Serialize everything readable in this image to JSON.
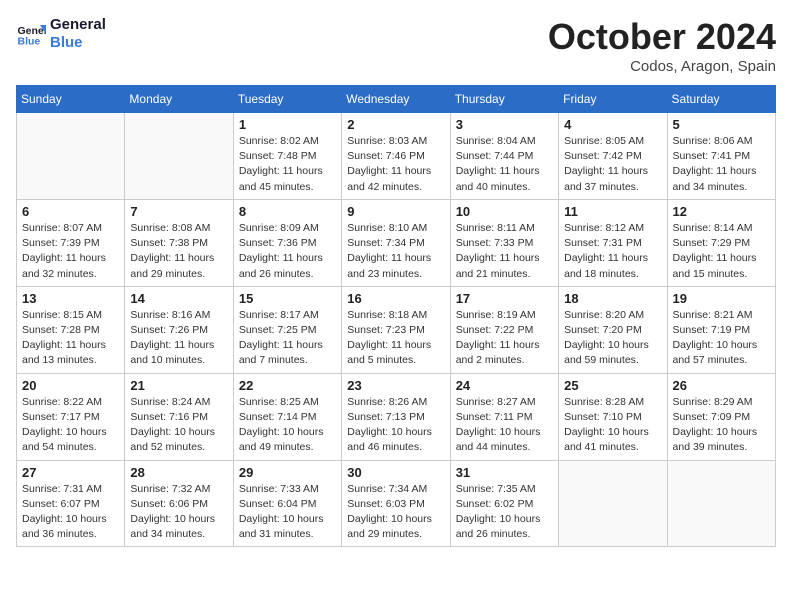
{
  "logo": {
    "text_general": "General",
    "text_blue": "Blue"
  },
  "header": {
    "month": "October 2024",
    "location": "Codos, Aragon, Spain"
  },
  "weekdays": [
    "Sunday",
    "Monday",
    "Tuesday",
    "Wednesday",
    "Thursday",
    "Friday",
    "Saturday"
  ],
  "weeks": [
    [
      {
        "day": "",
        "info": ""
      },
      {
        "day": "",
        "info": ""
      },
      {
        "day": "1",
        "info": "Sunrise: 8:02 AM\nSunset: 7:48 PM\nDaylight: 11 hours and 45 minutes."
      },
      {
        "day": "2",
        "info": "Sunrise: 8:03 AM\nSunset: 7:46 PM\nDaylight: 11 hours and 42 minutes."
      },
      {
        "day": "3",
        "info": "Sunrise: 8:04 AM\nSunset: 7:44 PM\nDaylight: 11 hours and 40 minutes."
      },
      {
        "day": "4",
        "info": "Sunrise: 8:05 AM\nSunset: 7:42 PM\nDaylight: 11 hours and 37 minutes."
      },
      {
        "day": "5",
        "info": "Sunrise: 8:06 AM\nSunset: 7:41 PM\nDaylight: 11 hours and 34 minutes."
      }
    ],
    [
      {
        "day": "6",
        "info": "Sunrise: 8:07 AM\nSunset: 7:39 PM\nDaylight: 11 hours and 32 minutes."
      },
      {
        "day": "7",
        "info": "Sunrise: 8:08 AM\nSunset: 7:38 PM\nDaylight: 11 hours and 29 minutes."
      },
      {
        "day": "8",
        "info": "Sunrise: 8:09 AM\nSunset: 7:36 PM\nDaylight: 11 hours and 26 minutes."
      },
      {
        "day": "9",
        "info": "Sunrise: 8:10 AM\nSunset: 7:34 PM\nDaylight: 11 hours and 23 minutes."
      },
      {
        "day": "10",
        "info": "Sunrise: 8:11 AM\nSunset: 7:33 PM\nDaylight: 11 hours and 21 minutes."
      },
      {
        "day": "11",
        "info": "Sunrise: 8:12 AM\nSunset: 7:31 PM\nDaylight: 11 hours and 18 minutes."
      },
      {
        "day": "12",
        "info": "Sunrise: 8:14 AM\nSunset: 7:29 PM\nDaylight: 11 hours and 15 minutes."
      }
    ],
    [
      {
        "day": "13",
        "info": "Sunrise: 8:15 AM\nSunset: 7:28 PM\nDaylight: 11 hours and 13 minutes."
      },
      {
        "day": "14",
        "info": "Sunrise: 8:16 AM\nSunset: 7:26 PM\nDaylight: 11 hours and 10 minutes."
      },
      {
        "day": "15",
        "info": "Sunrise: 8:17 AM\nSunset: 7:25 PM\nDaylight: 11 hours and 7 minutes."
      },
      {
        "day": "16",
        "info": "Sunrise: 8:18 AM\nSunset: 7:23 PM\nDaylight: 11 hours and 5 minutes."
      },
      {
        "day": "17",
        "info": "Sunrise: 8:19 AM\nSunset: 7:22 PM\nDaylight: 11 hours and 2 minutes."
      },
      {
        "day": "18",
        "info": "Sunrise: 8:20 AM\nSunset: 7:20 PM\nDaylight: 10 hours and 59 minutes."
      },
      {
        "day": "19",
        "info": "Sunrise: 8:21 AM\nSunset: 7:19 PM\nDaylight: 10 hours and 57 minutes."
      }
    ],
    [
      {
        "day": "20",
        "info": "Sunrise: 8:22 AM\nSunset: 7:17 PM\nDaylight: 10 hours and 54 minutes."
      },
      {
        "day": "21",
        "info": "Sunrise: 8:24 AM\nSunset: 7:16 PM\nDaylight: 10 hours and 52 minutes."
      },
      {
        "day": "22",
        "info": "Sunrise: 8:25 AM\nSunset: 7:14 PM\nDaylight: 10 hours and 49 minutes."
      },
      {
        "day": "23",
        "info": "Sunrise: 8:26 AM\nSunset: 7:13 PM\nDaylight: 10 hours and 46 minutes."
      },
      {
        "day": "24",
        "info": "Sunrise: 8:27 AM\nSunset: 7:11 PM\nDaylight: 10 hours and 44 minutes."
      },
      {
        "day": "25",
        "info": "Sunrise: 8:28 AM\nSunset: 7:10 PM\nDaylight: 10 hours and 41 minutes."
      },
      {
        "day": "26",
        "info": "Sunrise: 8:29 AM\nSunset: 7:09 PM\nDaylight: 10 hours and 39 minutes."
      }
    ],
    [
      {
        "day": "27",
        "info": "Sunrise: 7:31 AM\nSunset: 6:07 PM\nDaylight: 10 hours and 36 minutes."
      },
      {
        "day": "28",
        "info": "Sunrise: 7:32 AM\nSunset: 6:06 PM\nDaylight: 10 hours and 34 minutes."
      },
      {
        "day": "29",
        "info": "Sunrise: 7:33 AM\nSunset: 6:04 PM\nDaylight: 10 hours and 31 minutes."
      },
      {
        "day": "30",
        "info": "Sunrise: 7:34 AM\nSunset: 6:03 PM\nDaylight: 10 hours and 29 minutes."
      },
      {
        "day": "31",
        "info": "Sunrise: 7:35 AM\nSunset: 6:02 PM\nDaylight: 10 hours and 26 minutes."
      },
      {
        "day": "",
        "info": ""
      },
      {
        "day": "",
        "info": ""
      }
    ]
  ]
}
